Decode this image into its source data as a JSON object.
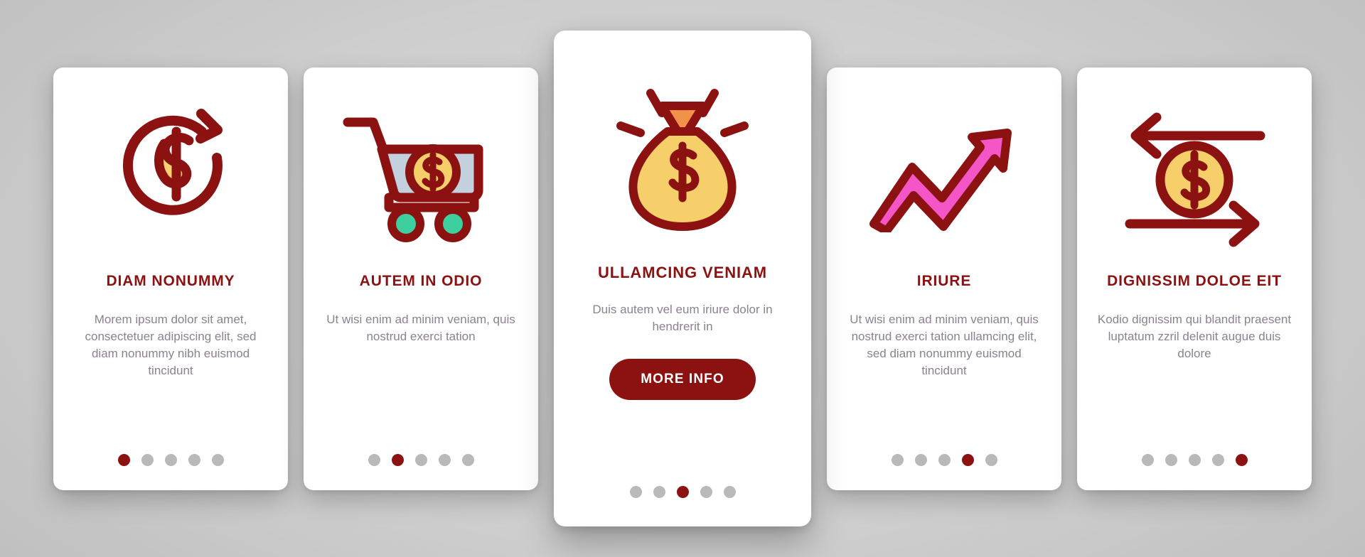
{
  "theme": {
    "background": "#cfcfcf",
    "card_background": "#ffffff",
    "accent_dark_red": "#8c1212",
    "icon_outline": "#8c1212",
    "coin_yellow": "#f7cf6a",
    "bag_top_orange": "#f2924a",
    "cart_fill_blue": "#c3d0de",
    "wheel_green": "#3ecf9e",
    "arrow_pink": "#f456c8",
    "dot_inactive": "#b9b9b9",
    "body_text": "#8b8191"
  },
  "cards": [
    {
      "id": "card-1",
      "icon": "dollar-refresh-circle-icon",
      "title": "DIAM NONUMMY",
      "description": "Morem ipsum dolor sit amet, consectetuer adipiscing elit, sed diam nonummy nibh euismod tincidunt",
      "has_button": false,
      "button_label": "",
      "dots": {
        "count": 5,
        "active_index": 0
      }
    },
    {
      "id": "card-2",
      "icon": "shopping-cart-coin-icon",
      "title": "AUTEM IN ODIO",
      "description": "Ut wisi enim ad minim veniam, quis nostrud exerci tation",
      "has_button": false,
      "button_label": "",
      "dots": {
        "count": 5,
        "active_index": 1
      }
    },
    {
      "id": "card-3",
      "icon": "money-bag-icon",
      "title": "ULLAMCING VENIAM",
      "description": "Duis autem vel eum iriure dolor in hendrerit in",
      "has_button": true,
      "button_label": "MORE INFO",
      "dots": {
        "count": 5,
        "active_index": 2
      }
    },
    {
      "id": "card-4",
      "icon": "growth-arrow-icon",
      "title": "IRIURE",
      "description": "Ut wisi enim ad minim veniam, quis nostrud exerci tation ullamcing elit, sed diam nonummy euismod tincidunt",
      "has_button": false,
      "button_label": "",
      "dots": {
        "count": 5,
        "active_index": 3
      }
    },
    {
      "id": "card-5",
      "icon": "money-exchange-coin-icon",
      "title": "DIGNISSIM DOLOE EIT",
      "description": "Kodio dignissim qui blandit praesent luptatum zzril delenit augue duis dolore",
      "has_button": false,
      "button_label": "",
      "dots": {
        "count": 5,
        "active_index": 4
      }
    }
  ]
}
